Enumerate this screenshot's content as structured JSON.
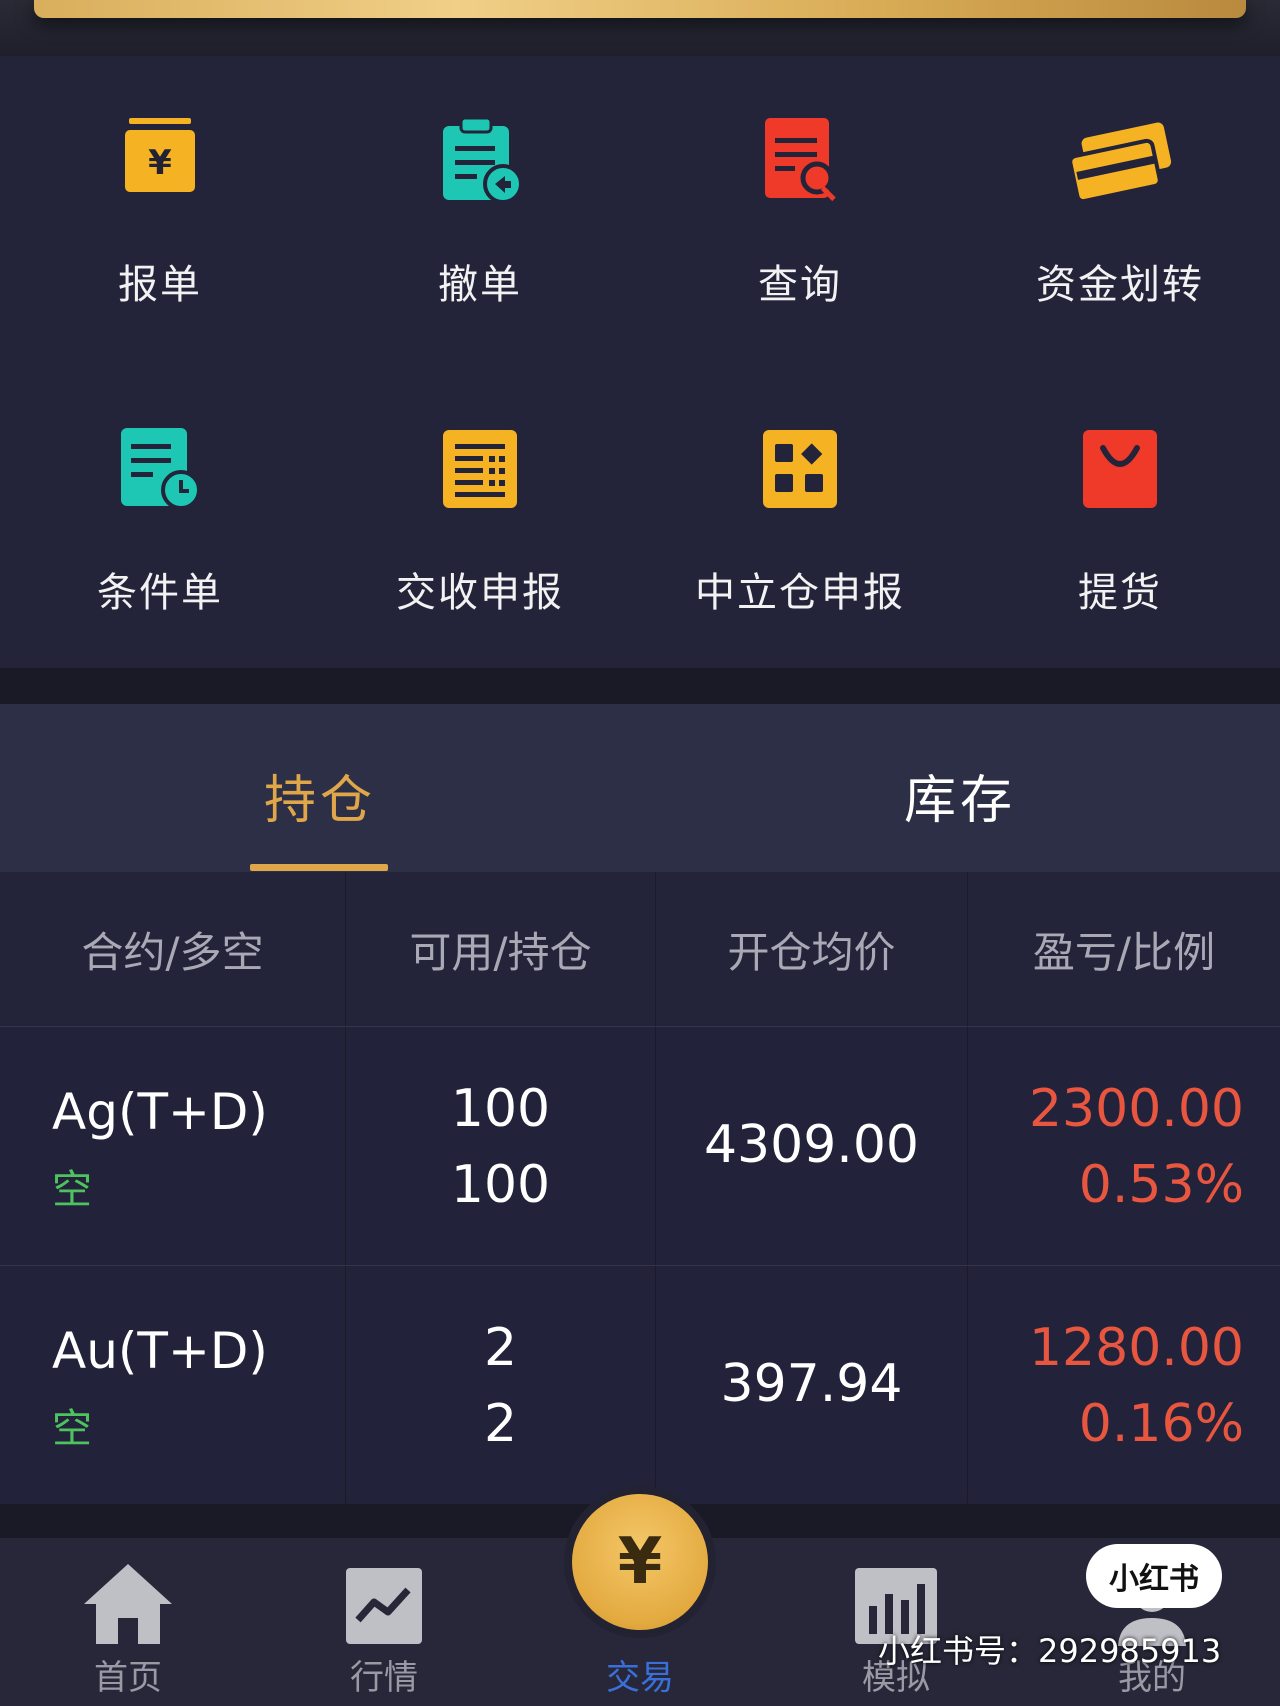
{
  "actions": [
    {
      "label": "报单",
      "icon": "order-yen-icon",
      "color": "#f5b324"
    },
    {
      "label": "撤单",
      "icon": "cancel-order-icon",
      "color": "#1ec7b4"
    },
    {
      "label": "查询",
      "icon": "query-search-icon",
      "color": "#ef3a2a"
    },
    {
      "label": "资金划转",
      "icon": "fund-transfer-card-icon",
      "color": "#f5b324"
    },
    {
      "label": "条件单",
      "icon": "conditional-order-clock-icon",
      "color": "#1ec7b4"
    },
    {
      "label": "交收申报",
      "icon": "delivery-declaration-icon",
      "color": "#f5b324"
    },
    {
      "label": "中立仓申报",
      "icon": "neutral-warehouse-icon",
      "color": "#f5b324"
    },
    {
      "label": "提货",
      "icon": "pickup-bag-icon",
      "color": "#ef3a2a"
    }
  ],
  "tabs": [
    {
      "label": "持仓",
      "active": true
    },
    {
      "label": "库存",
      "active": false
    }
  ],
  "table": {
    "headers": [
      "合约/多空",
      "可用/持仓",
      "开仓均价",
      "盈亏/比例"
    ],
    "rows": [
      {
        "contract": "Ag(T+D)",
        "direction": "空",
        "available": "100",
        "holding": "100",
        "avg_price": "4309.00",
        "pnl": "2300.00",
        "ratio": "0.53%"
      },
      {
        "contract": "Au(T+D)",
        "direction": "空",
        "available": "2",
        "holding": "2",
        "avg_price": "397.94",
        "pnl": "1280.00",
        "ratio": "0.16%"
      }
    ]
  },
  "nav": [
    {
      "label": "首页",
      "icon": "home-icon",
      "active": false
    },
    {
      "label": "行情",
      "icon": "market-chart-icon",
      "active": false
    },
    {
      "label": "交易",
      "icon": "trade-yen-icon",
      "active": true
    },
    {
      "label": "模拟",
      "icon": "simulate-bars-icon",
      "active": false
    },
    {
      "label": "我的",
      "icon": "profile-icon",
      "active": false
    }
  ],
  "center_symbol": "¥",
  "watermark": {
    "badge": "小红书",
    "text": "小红书号：292985913"
  },
  "colors": {
    "accent": "#dfa64a",
    "loss_red": "#e8563f",
    "short_green": "#4ec25e",
    "active_nav": "#3a6fd9"
  }
}
